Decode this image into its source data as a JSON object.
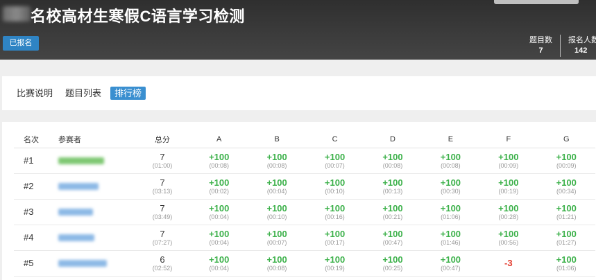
{
  "header": {
    "title": "名校高材生寒假C语言学习检测",
    "registered_label": "已报名",
    "stats": [
      {
        "label": "题目数",
        "value": "7"
      },
      {
        "label": "报名人数",
        "value": "142"
      }
    ]
  },
  "tabs": [
    {
      "label": "比赛说明",
      "active": false
    },
    {
      "label": "题目列表",
      "active": false
    },
    {
      "label": "排行榜",
      "active": true
    }
  ],
  "ranking": {
    "headers": {
      "rank": "名次",
      "user": "参赛者",
      "total": "总分",
      "problems": [
        "A",
        "B",
        "C",
        "D",
        "E",
        "F",
        "G"
      ]
    },
    "rows": [
      {
        "rank": "#1",
        "name_color": "#7fc873",
        "total": "7",
        "total_time": "(01:00)",
        "cells": [
          {
            "score": "+100",
            "time": "(00:08)",
            "status": "ok"
          },
          {
            "score": "+100",
            "time": "(00:08)",
            "status": "ok"
          },
          {
            "score": "+100",
            "time": "(00:07)",
            "status": "ok"
          },
          {
            "score": "+100",
            "time": "(00:08)",
            "status": "ok"
          },
          {
            "score": "+100",
            "time": "(00:08)",
            "status": "ok"
          },
          {
            "score": "+100",
            "time": "(00:09)",
            "status": "ok"
          },
          {
            "score": "+100",
            "time": "(00:09)",
            "status": "ok"
          }
        ]
      },
      {
        "rank": "#2",
        "name_color": "#8db9e6",
        "total": "7",
        "total_time": "(03:13)",
        "cells": [
          {
            "score": "+100",
            "time": "(00:02)",
            "status": "ok"
          },
          {
            "score": "+100",
            "time": "(00:04)",
            "status": "ok"
          },
          {
            "score": "+100",
            "time": "(00:10)",
            "status": "ok"
          },
          {
            "score": "+100",
            "time": "(00:13)",
            "status": "ok"
          },
          {
            "score": "+100",
            "time": "(00:30)",
            "status": "ok"
          },
          {
            "score": "+100",
            "time": "(00:19)",
            "status": "ok"
          },
          {
            "score": "+100",
            "time": "(00:34)",
            "status": "ok"
          }
        ]
      },
      {
        "rank": "#3",
        "name_color": "#8db9e6",
        "total": "7",
        "total_time": "(03:49)",
        "cells": [
          {
            "score": "+100",
            "time": "(00:04)",
            "status": "ok"
          },
          {
            "score": "+100",
            "time": "(00:10)",
            "status": "ok"
          },
          {
            "score": "+100",
            "time": "(00:16)",
            "status": "ok"
          },
          {
            "score": "+100",
            "time": "(00:21)",
            "status": "ok"
          },
          {
            "score": "+100",
            "time": "(01:06)",
            "status": "ok"
          },
          {
            "score": "+100",
            "time": "(00:28)",
            "status": "ok"
          },
          {
            "score": "+100",
            "time": "(01:21)",
            "status": "ok"
          }
        ]
      },
      {
        "rank": "#4",
        "name_color": "#8db9e6",
        "total": "7",
        "total_time": "(07:27)",
        "cells": [
          {
            "score": "+100",
            "time": "(00:04)",
            "status": "ok"
          },
          {
            "score": "+100",
            "time": "(00:07)",
            "status": "ok"
          },
          {
            "score": "+100",
            "time": "(00:17)",
            "status": "ok"
          },
          {
            "score": "+100",
            "time": "(00:47)",
            "status": "ok"
          },
          {
            "score": "+100",
            "time": "(01:46)",
            "status": "ok"
          },
          {
            "score": "+100",
            "time": "(00:56)",
            "status": "ok"
          },
          {
            "score": "+100",
            "time": "(01:27)",
            "status": "ok"
          }
        ]
      },
      {
        "rank": "#5",
        "name_color": "#8db9e6",
        "total": "6",
        "total_time": "(02:52)",
        "cells": [
          {
            "score": "+100",
            "time": "(00:04)",
            "status": "ok"
          },
          {
            "score": "+100",
            "time": "(00:08)",
            "status": "ok"
          },
          {
            "score": "+100",
            "time": "(00:19)",
            "status": "ok"
          },
          {
            "score": "+100",
            "time": "(00:25)",
            "status": "ok"
          },
          {
            "score": "+100",
            "time": "(00:47)",
            "status": "ok"
          },
          {
            "score": "-3",
            "time": "",
            "status": "fail"
          },
          {
            "score": "+100",
            "time": "(01:06)",
            "status": "ok"
          }
        ]
      }
    ]
  },
  "colors": {
    "accent": "#3a8fd0",
    "ok": "#3cb14a",
    "fail": "#e23a2c",
    "header_bg": "#333333"
  }
}
